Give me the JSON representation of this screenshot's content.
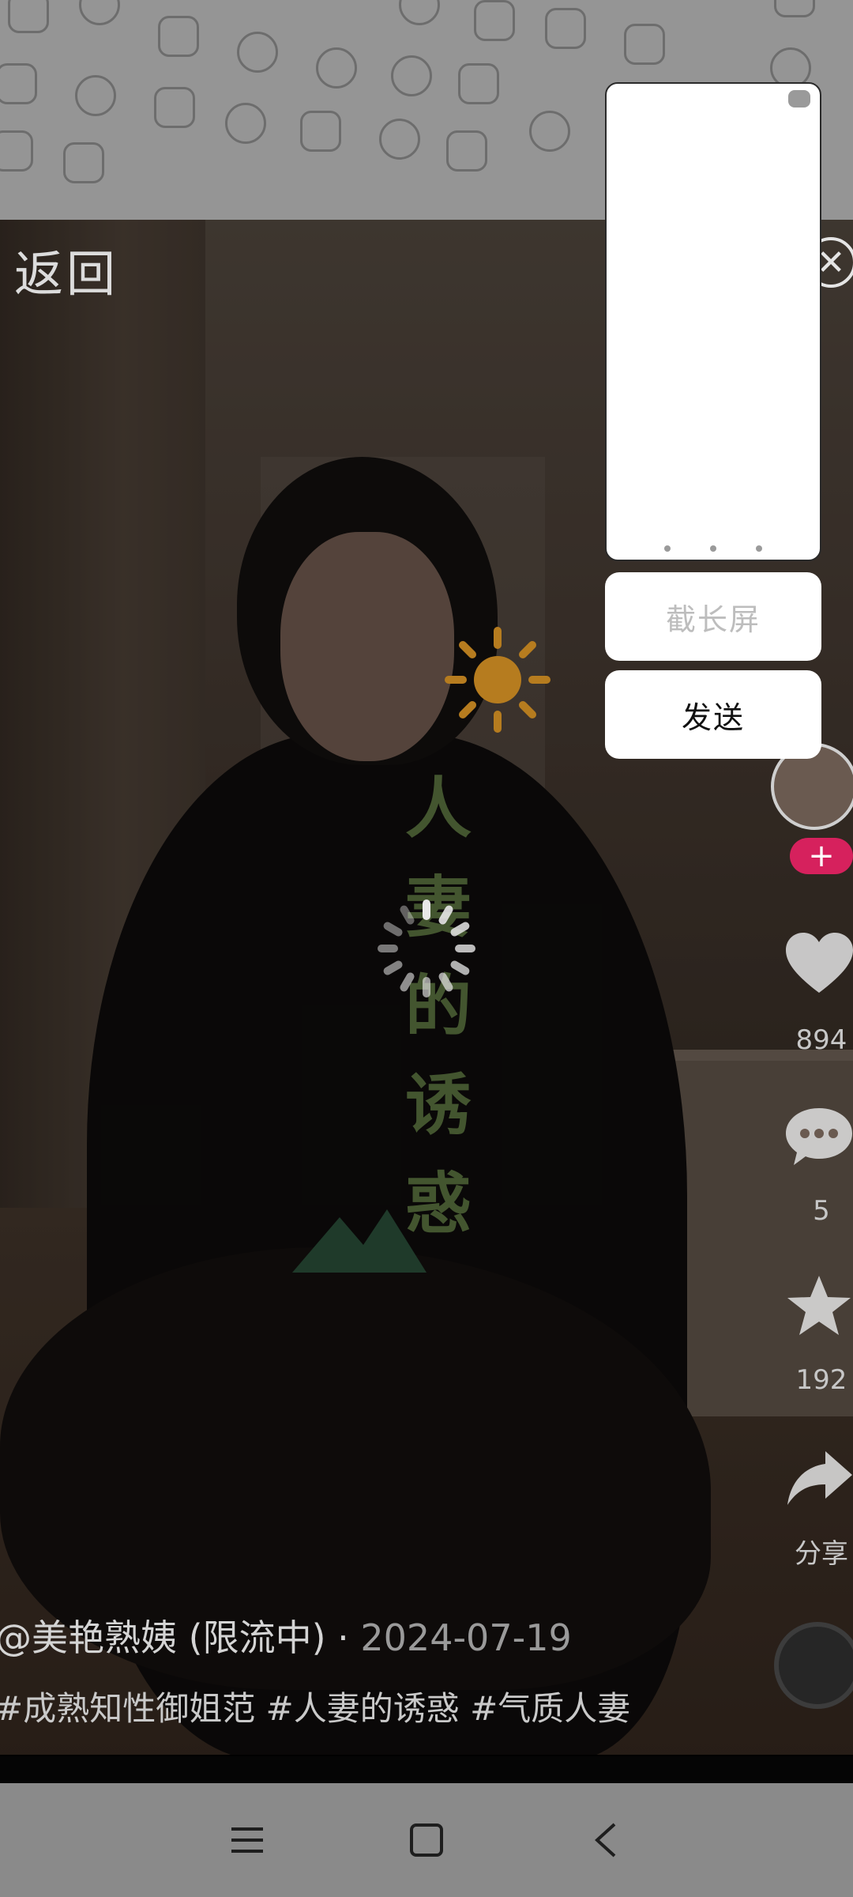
{
  "header": {
    "back_label": "返回",
    "close_icon": "close-icon"
  },
  "video_overlay": {
    "title_chars": [
      "人",
      "妻",
      "的",
      "诱",
      "惑"
    ],
    "sun_icon": "sun-icon",
    "mountain_icon": "mountain-icon",
    "loading_icon": "loading-spinner-icon"
  },
  "actions": {
    "likes": "894",
    "comments": "5",
    "favorites": "192",
    "share_label": "分享",
    "follow_icon": "plus-icon"
  },
  "caption": {
    "author": "@美艳熟姨 (限流中)",
    "date": "2024-07-19",
    "tags": "#成熟知性御姐范 #人妻的诱惑 #气质人妻"
  },
  "screenshot_panel": {
    "long_screenshot_label": "截长屏",
    "send_label": "发送"
  },
  "navbar": {
    "menu_icon": "menu-icon",
    "home_icon": "home-icon",
    "back_icon": "back-icon"
  },
  "colors": {
    "title_green": "#43552f",
    "follow_red": "#d6215d",
    "navbar_gray": "#8a8a8a"
  }
}
